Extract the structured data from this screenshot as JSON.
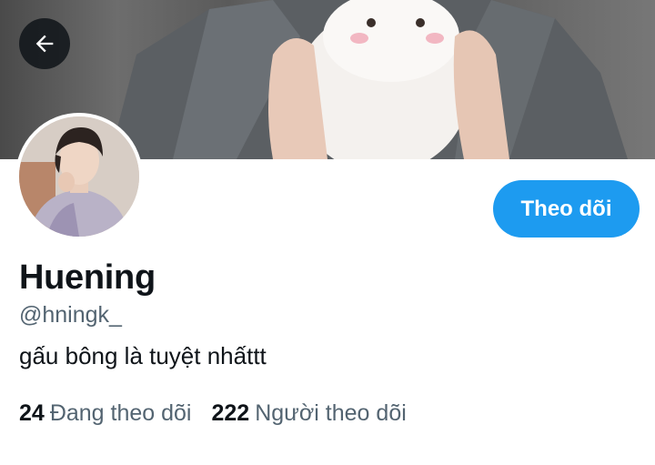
{
  "header": {
    "back_icon": "arrow-left-icon"
  },
  "profile": {
    "name": "Huening",
    "handle": "@hningk_",
    "bio": "gấu bông là tuyệt nhấttt",
    "follow_button": "Theo dõi"
  },
  "stats": {
    "following_count": "24",
    "following_label": "Đang theo dõi",
    "followers_count": "222",
    "followers_label": "Người theo dõi"
  },
  "colors": {
    "accent": "#1d9bf0",
    "text_primary": "#0f1419",
    "text_secondary": "#536471"
  }
}
